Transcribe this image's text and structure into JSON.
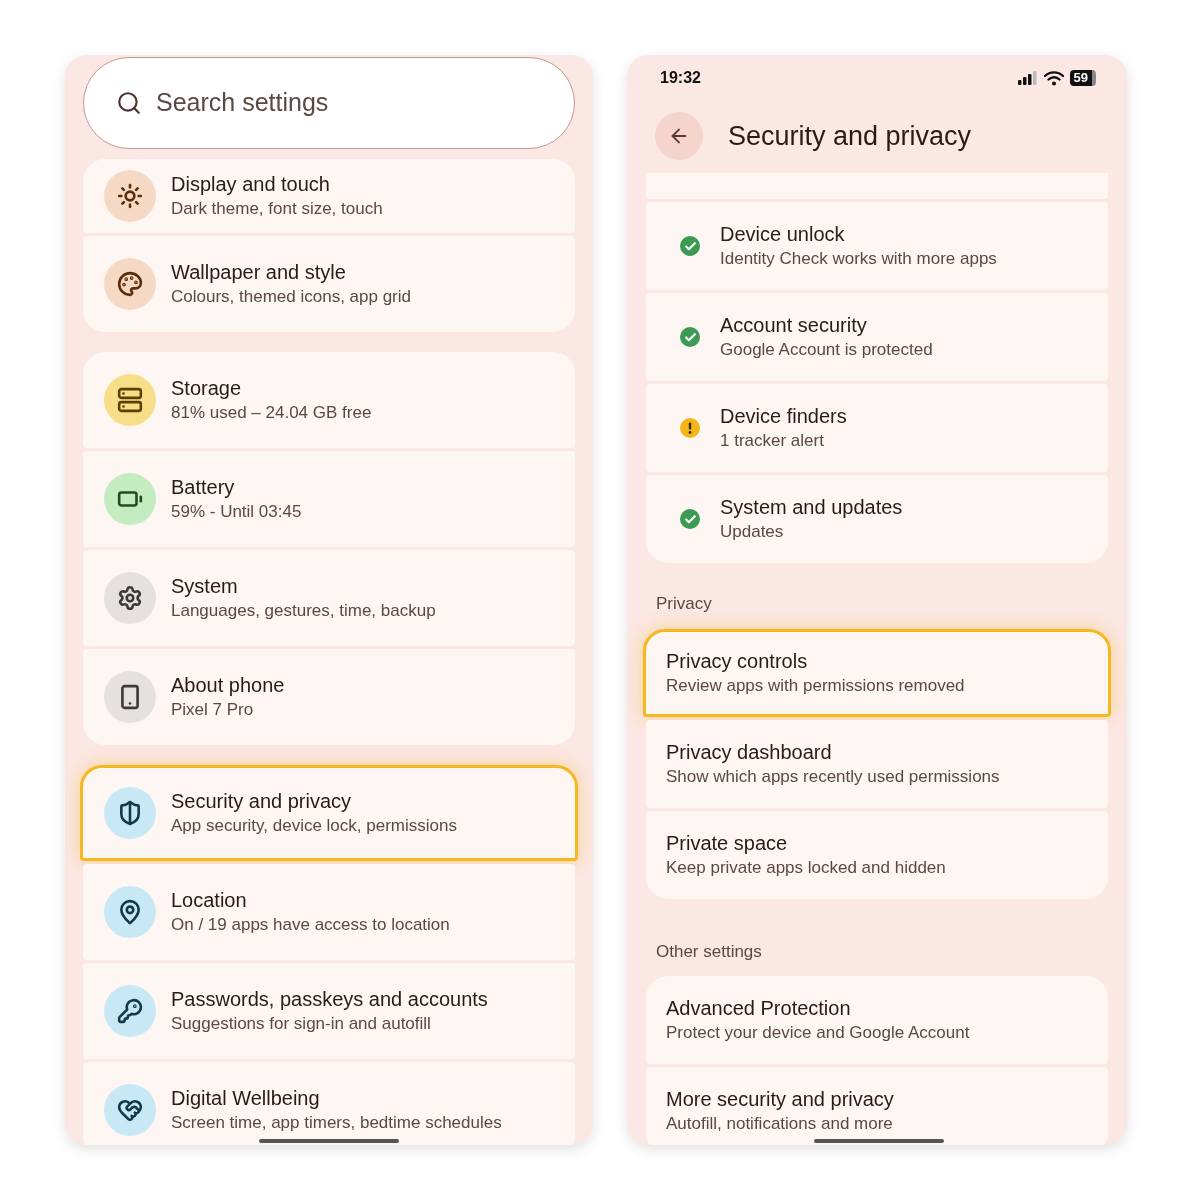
{
  "settings_screen": {
    "search": {
      "placeholder": "Search settings"
    },
    "groups": [
      [
        {
          "title": "Display and touch",
          "subtitle": "Dark theme, font size, touch",
          "highlighted": false
        },
        {
          "title": "Wallpaper and style",
          "subtitle": "Colours, themed icons, app grid",
          "highlighted": false
        }
      ],
      [
        {
          "title": "Storage",
          "subtitle": "81% used – 24.04 GB free",
          "highlighted": false
        },
        {
          "title": "Battery",
          "subtitle": "59% - Until 03:45",
          "highlighted": false
        },
        {
          "title": "System",
          "subtitle": "Languages, gestures, time, backup",
          "highlighted": false
        },
        {
          "title": "About phone",
          "subtitle": "Pixel 7 Pro",
          "highlighted": false
        }
      ],
      [
        {
          "title": "Security and privacy",
          "subtitle": "App security, device lock, permissions",
          "highlighted": true
        },
        {
          "title": "Location",
          "subtitle": "On / 19 apps have access to location",
          "highlighted": false
        },
        {
          "title": "Passwords, passkeys and accounts",
          "subtitle": "Suggestions for sign-in and autofill",
          "highlighted": false
        },
        {
          "title": "Digital Wellbeing",
          "subtitle": "Screen time, app timers, bedtime schedules",
          "highlighted": false
        }
      ]
    ]
  },
  "security_screen": {
    "status_bar": {
      "time": "19:32",
      "battery": "59"
    },
    "title": "Security and privacy",
    "status_items": [
      {
        "title": "Device unlock",
        "subtitle": "Identity Check works with more apps",
        "kind": "ok"
      },
      {
        "title": "Account security",
        "subtitle": "Google Account is protected",
        "kind": "ok"
      },
      {
        "title": "Device finders",
        "subtitle": "1 tracker alert",
        "kind": "warning"
      },
      {
        "title": "System and updates",
        "subtitle": "Updates",
        "kind": "ok"
      }
    ],
    "sections": [
      {
        "heading": "Privacy",
        "items": [
          {
            "title": "Privacy controls",
            "subtitle": "Review apps with permissions removed",
            "highlighted": true
          },
          {
            "title": "Privacy dashboard",
            "subtitle": "Show which apps recently used permissions",
            "highlighted": false
          },
          {
            "title": "Private space",
            "subtitle": "Keep private apps locked and hidden",
            "highlighted": false
          }
        ]
      },
      {
        "heading": "Other settings",
        "items": [
          {
            "title": "Advanced Protection",
            "subtitle": "Protect your device and Google Account",
            "highlighted": false
          },
          {
            "title": "More security and privacy",
            "subtitle": "Autofill, notifications and more",
            "highlighted": false
          }
        ]
      }
    ]
  }
}
